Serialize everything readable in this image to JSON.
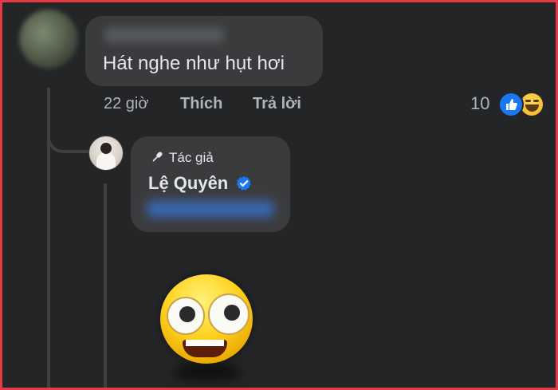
{
  "comment": {
    "text": "Hát nghe như hụt hơi",
    "actions": {
      "time": "22 giờ",
      "like": "Thích",
      "reply": "Trả lời"
    },
    "reactions": {
      "count": "10",
      "icons": [
        "like-icon",
        "haha-icon"
      ]
    }
  },
  "reply": {
    "badge": "Tác giả",
    "author": "Lệ Quyên",
    "verified": true
  },
  "colors": {
    "background": "#242526",
    "bubble": "#3a3b3c",
    "text": "#e4e6eb",
    "secondary_text": "#b0b3b8",
    "like_blue": "#1877f2",
    "frame_red": "#e63946"
  }
}
